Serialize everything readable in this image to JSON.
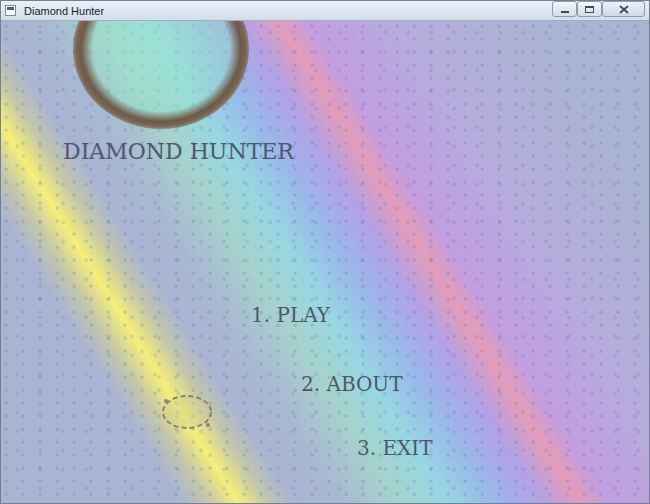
{
  "window": {
    "title": "Diamond Hunter"
  },
  "game": {
    "title": "DIAMOND HUNTER",
    "menu": [
      {
        "label": "1. PLAY"
      },
      {
        "label": "2. ABOUT"
      },
      {
        "label": "3. EXIT"
      }
    ]
  }
}
